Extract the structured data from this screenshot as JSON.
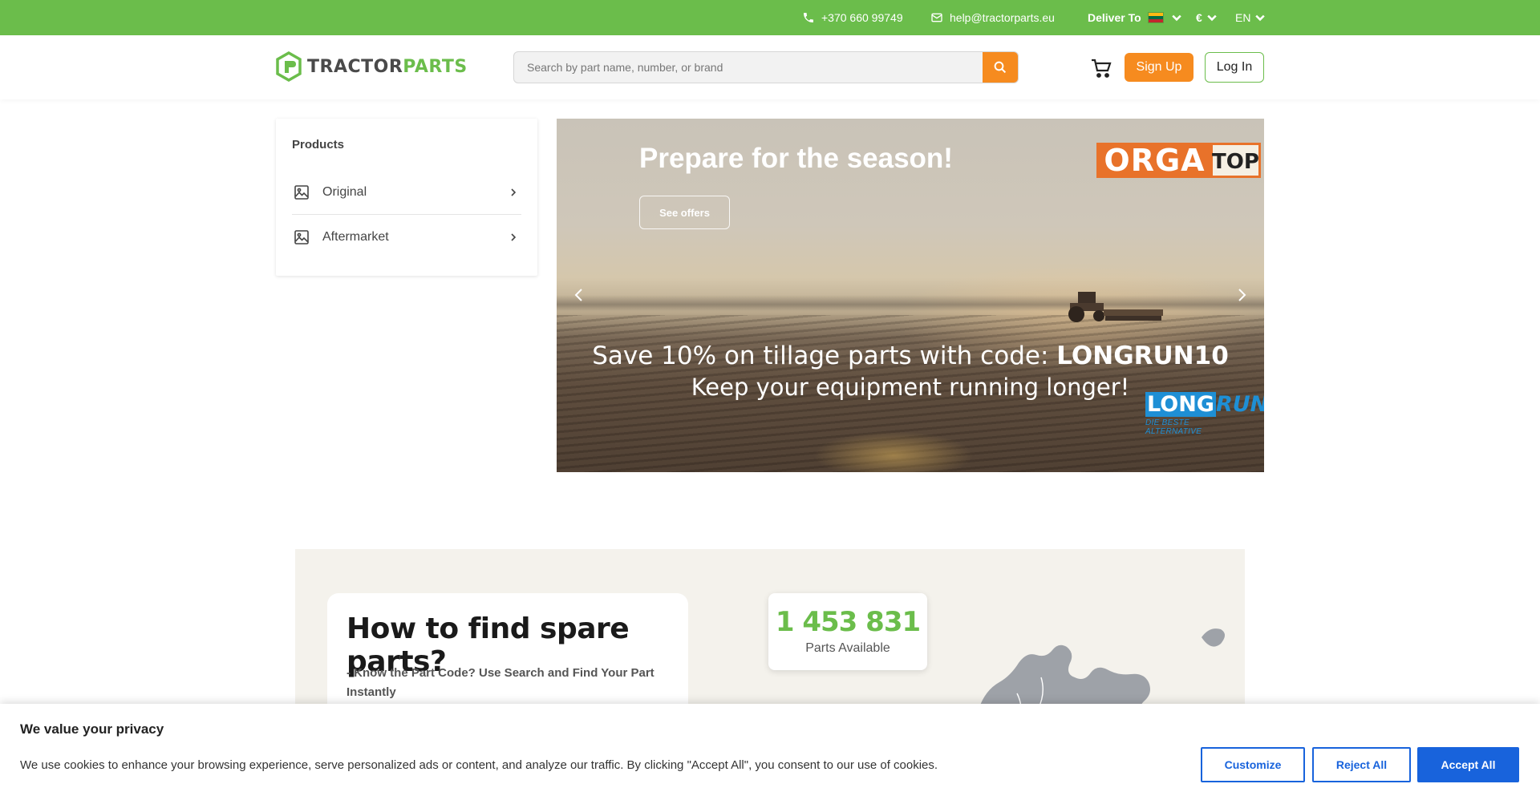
{
  "topbar": {
    "phone": "+370 660 99749",
    "email": "help@tractorparts.eu",
    "deliver_label": "Deliver To",
    "currency": "€",
    "language": "EN",
    "bg_color": "#6bbd4b"
  },
  "header": {
    "logo_part1": "TRACTOR",
    "logo_part2": "PARTS",
    "search_placeholder": "Search by part name, number, or brand",
    "signup_label": "Sign Up",
    "login_label": "Log In",
    "accent_color": "#f68b1f"
  },
  "products": {
    "title": "Products",
    "items": [
      {
        "label": "Original"
      },
      {
        "label": "Aftermarket"
      }
    ]
  },
  "banner": {
    "title": "Prepare for the season!",
    "button_label": "See offers",
    "orga_brand_1": "ORGA",
    "orga_brand_2": "TOP",
    "promo_line1_prefix": "Save 10% on tillage parts with code: ",
    "promo_code": "LONGRUN10",
    "promo_line2": "Keep your equipment running longer!",
    "longrun_brand_1": "LONG",
    "longrun_brand_2": "RUN",
    "longrun_tagline": "DIE BESTE ALTERNATIVE"
  },
  "info": {
    "heading": "How to find spare parts?",
    "step1": "- Know the Part Code? Use Search and Find Your Part Instantly",
    "parts_count": "1 453 831",
    "parts_label": "Parts Available"
  },
  "cookie": {
    "title": "We value your privacy",
    "text": "We use cookies to enhance your browsing experience, serve personalized ads or content, and analyze our traffic. By clicking \"Accept All\", you consent to our use of cookies.",
    "customize_label": "Customize",
    "reject_label": "Reject All",
    "accept_label": "Accept All",
    "button_color": "#1863dc"
  }
}
